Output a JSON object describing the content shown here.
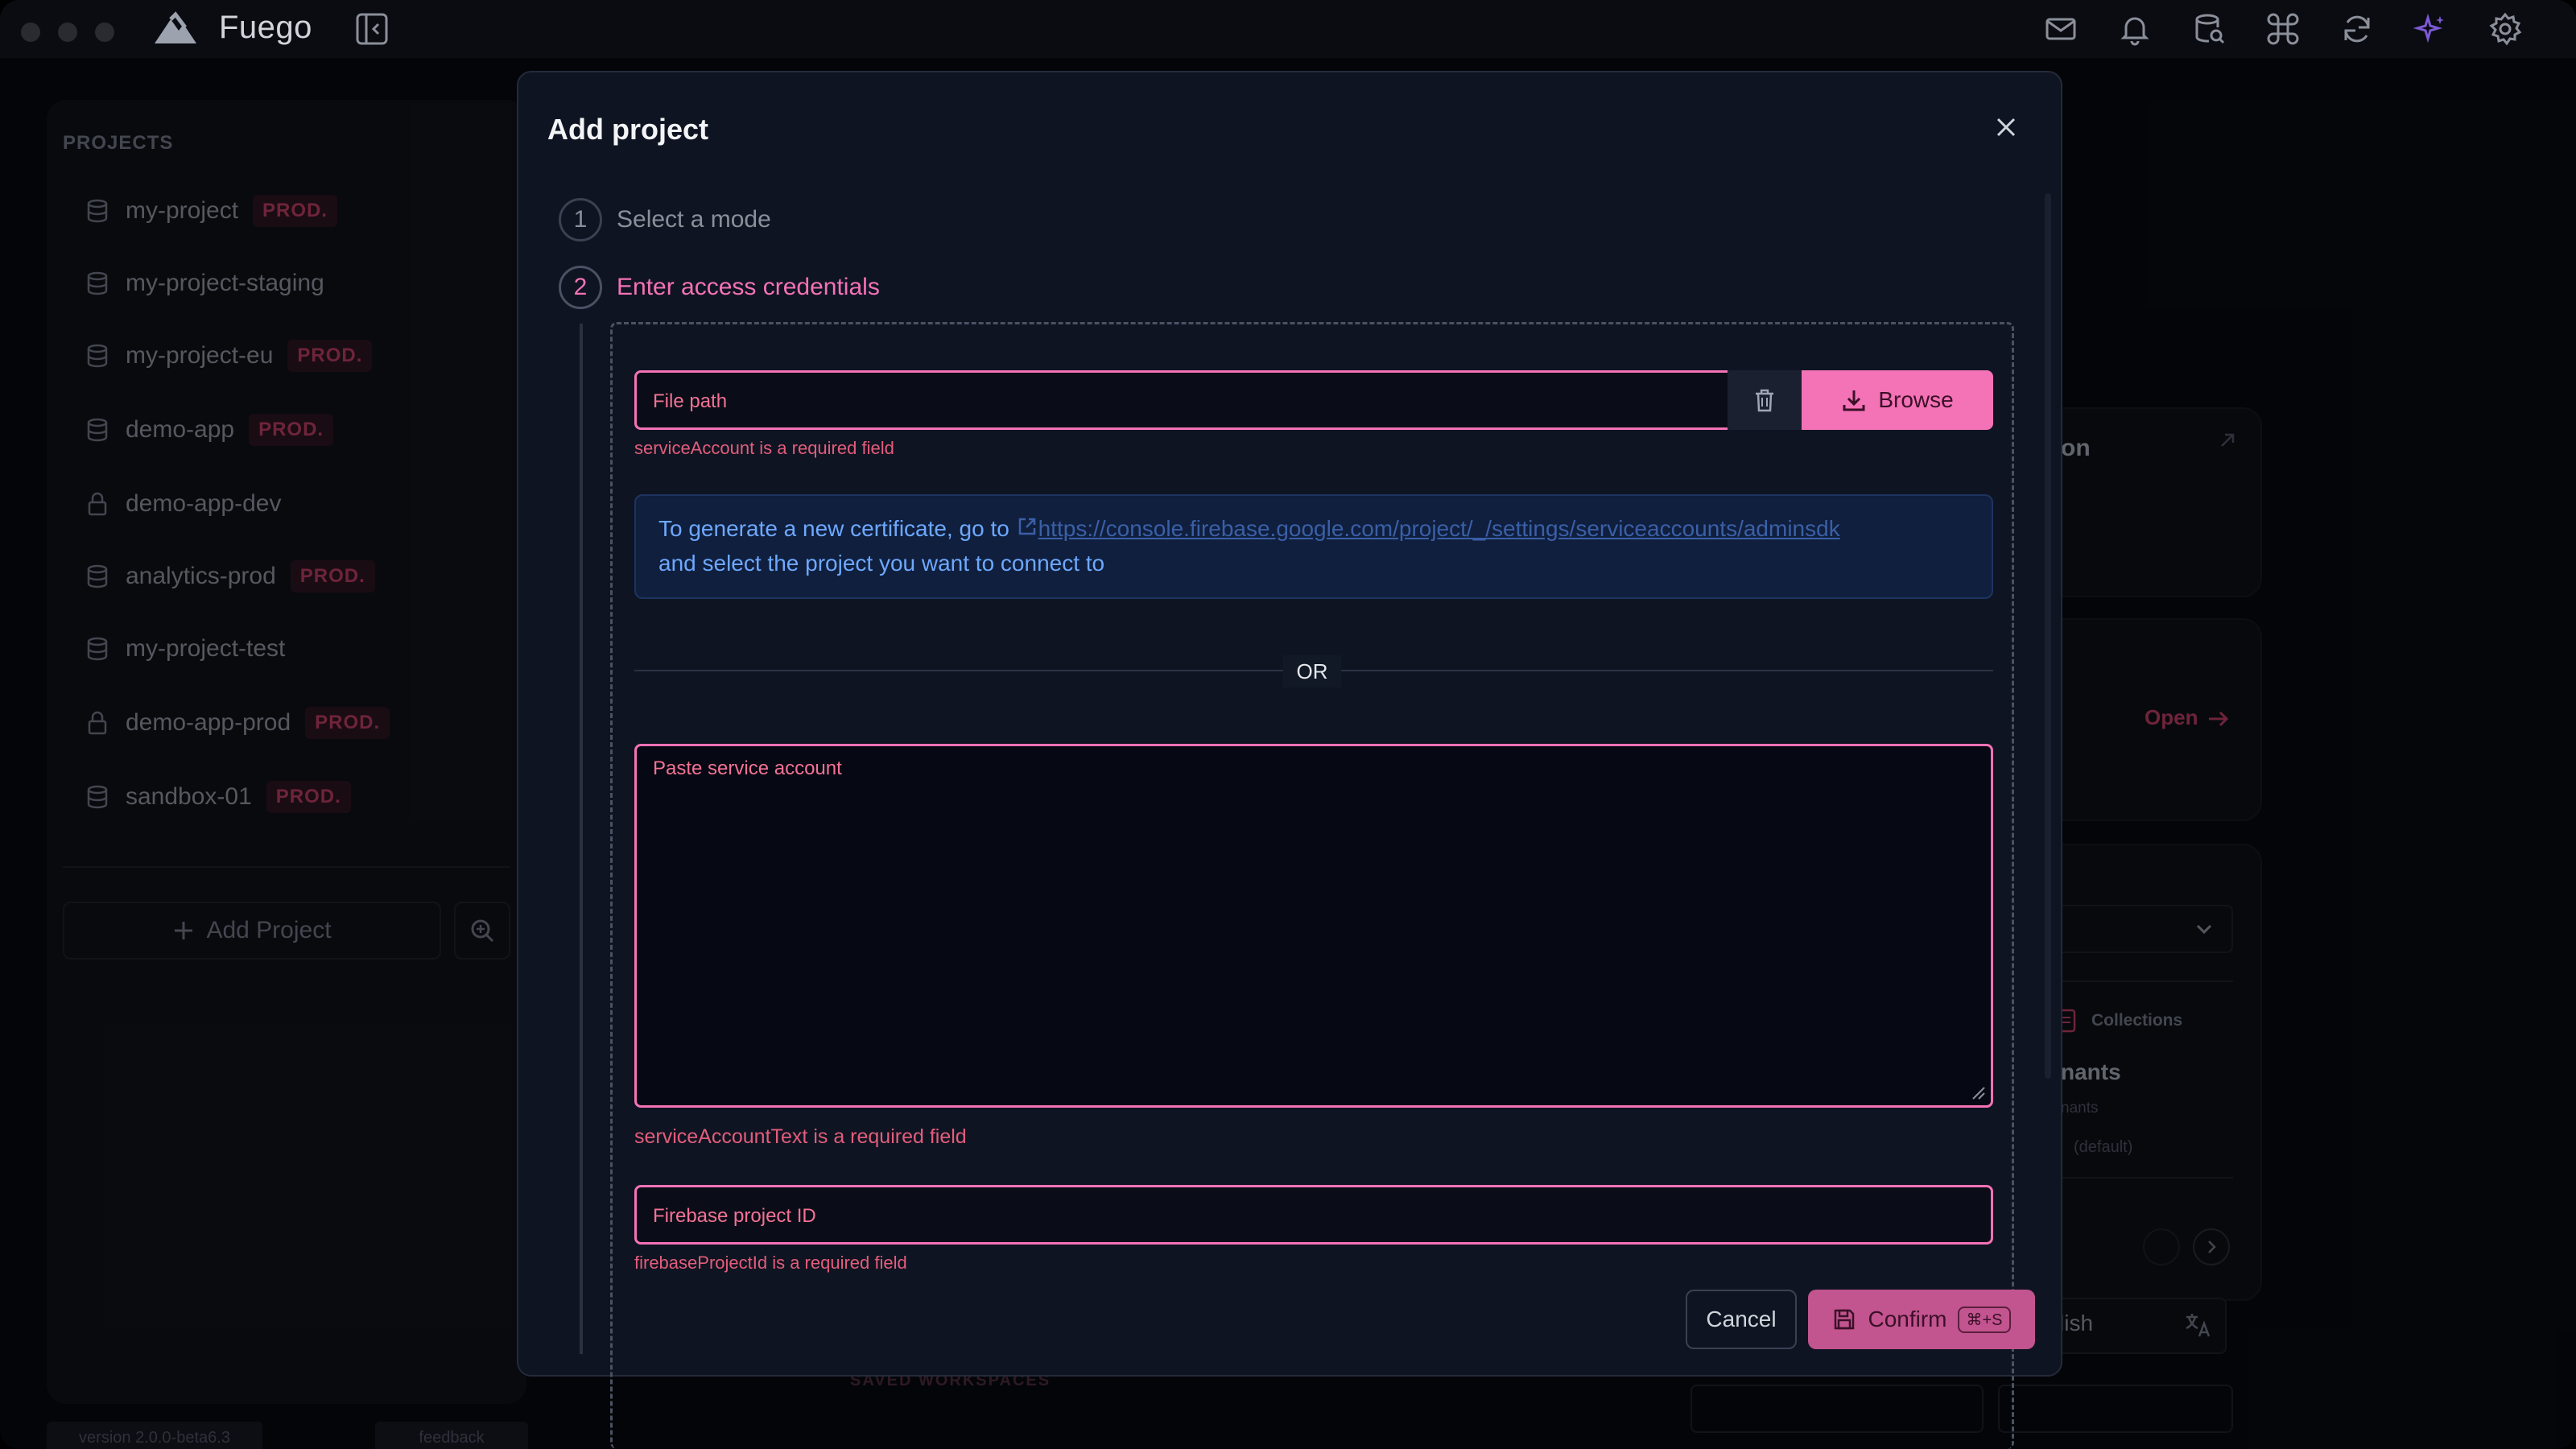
{
  "app": {
    "name": "Fuego"
  },
  "sidebar": {
    "heading": "PROJECTS",
    "projects": [
      {
        "name": "my-project",
        "badge": "PROD.",
        "icon": "database-icon"
      },
      {
        "name": "my-project-staging",
        "badge": "",
        "icon": "database-icon"
      },
      {
        "name": "my-project-eu",
        "badge": "PROD.",
        "icon": "database-icon"
      },
      {
        "name": "demo-app",
        "badge": "PROD.",
        "icon": "database-icon"
      },
      {
        "name": "demo-app-dev",
        "badge": "",
        "icon": "lock-icon"
      },
      {
        "name": "analytics-prod",
        "badge": "PROD.",
        "icon": "database-icon"
      },
      {
        "name": "my-project-test",
        "badge": "",
        "icon": "database-icon"
      },
      {
        "name": "demo-app-prod",
        "badge": "PROD.",
        "icon": "lock-icon"
      },
      {
        "name": "sandbox-01",
        "badge": "PROD.",
        "icon": "database-icon"
      }
    ],
    "add_project_label": "Add Project",
    "version": "version 2.0.0-beta6.3",
    "feedback": "feedback"
  },
  "background": {
    "card1_fragment": "on",
    "open_label": "Open",
    "collections_label": "Collections",
    "tenants_fragment": "nants",
    "tenants_sub": "nants",
    "default_label": "(default)",
    "language_fragment": "lish",
    "saved_workspaces": "SAVED WORKSPACES"
  },
  "modal": {
    "title": "Add project",
    "steps": [
      {
        "number": "1",
        "label": "Select a mode"
      },
      {
        "number": "2",
        "label": "Enter access credentials"
      }
    ],
    "file_path_placeholder": "File path",
    "browse_label": "Browse",
    "file_error": "serviceAccount is a required field",
    "info_prefix": "To generate a new certificate, go to",
    "info_link": "https://console.firebase.google.com/project/_/settings/serviceaccounts/adminsdk",
    "info_suffix": "and select the project you want to connect to",
    "or_label": "OR",
    "paste_placeholder": "Paste service account",
    "paste_error": "serviceAccountText is a required field",
    "project_id_placeholder": "Firebase project ID",
    "project_id_error": "firebaseProjectId is a required field",
    "cancel_label": "Cancel",
    "confirm_label": "Confirm",
    "confirm_shortcut": "⌘+S"
  },
  "colors": {
    "accent": "#f472b6",
    "error": "#e35d7b",
    "info": "#6ea8ff",
    "background": "#08090e"
  }
}
